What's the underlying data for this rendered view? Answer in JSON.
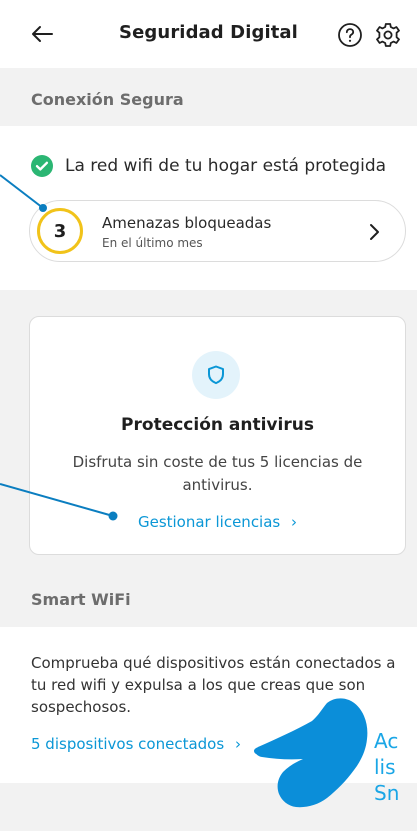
{
  "header": {
    "title": "Seguridad Digital"
  },
  "conexion": {
    "section_title": "Conexión Segura",
    "status_text": "La red wifi de tu hogar está protegida",
    "threats": {
      "count": "3",
      "title": "Amenazas bloqueadas",
      "subtitle": "En el último mes"
    }
  },
  "antivirus": {
    "title": "Protección antivirus",
    "description": "Disfruta sin coste de tus 5 licencias de antivirus.",
    "link": "Gestionar licencias"
  },
  "smartwifi": {
    "section_title": "Smart WiFi",
    "description": "Comprueba qué dispositivos están conectados a tu red wifi y expulsa a los que creas que son sospechosos.",
    "link": "5 dispositivos conectados"
  },
  "hint": {
    "line1": "Ac",
    "line2": "lis",
    "line3": "Sn"
  },
  "colors": {
    "accent": "#0b97d6",
    "success": "#2bb673",
    "warning": "#f1c31a",
    "annotation": "#0b7ec0"
  },
  "icons": [
    "back-arrow-icon",
    "help-icon",
    "settings-gear-icon",
    "check-circle-icon",
    "chevron-right-icon",
    "shield-icon",
    "pointing-hand-icon"
  ]
}
